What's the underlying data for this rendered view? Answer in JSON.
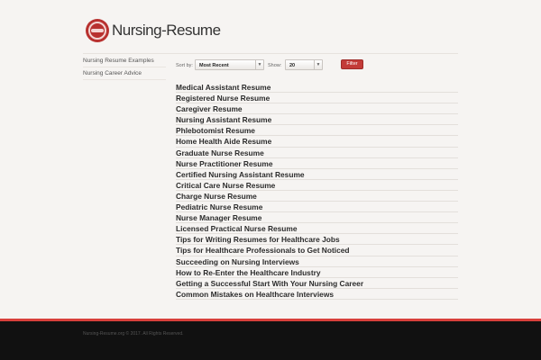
{
  "header": {
    "logo_text": "Nursing-Resume",
    "logo_icon": "nursing-cap-icon"
  },
  "sidebar": {
    "items": [
      {
        "label": "Nursing Resume Examples"
      },
      {
        "label": "Nursing Career Advice"
      }
    ]
  },
  "controls": {
    "sort_label": "Sort by:",
    "sort_value": "Most Recent",
    "show_label": "Show:",
    "show_value": "20",
    "filter_label": "Filter",
    "accent_color": "#c33b38"
  },
  "articles": [
    "Medical Assistant Resume",
    "Registered Nurse Resume",
    "Caregiver Resume",
    "Nursing Assistant Resume",
    "Phlebotomist Resume",
    "Home Health Aide Resume",
    "Graduate Nurse Resume",
    "Nurse Practitioner Resume",
    "Certified Nursing Assistant Resume",
    "Critical Care Nurse Resume",
    "Charge Nurse Resume",
    "Pediatric Nurse Resume",
    "Nurse Manager Resume",
    "Licensed Practical Nurse Resume",
    "Tips for Writing Resumes for Healthcare Jobs",
    "Tips for Healthcare Professionals to Get Noticed",
    "Succeeding on Nursing Interviews",
    "How to Re-Enter the Healthcare Industry",
    "Getting a Successful Start With Your Nursing Career",
    "Common Mistakes on Healthcare Interviews"
  ],
  "footer": {
    "copyright": "Nursing-Resume.org © 2017. All Rights Reserved."
  }
}
